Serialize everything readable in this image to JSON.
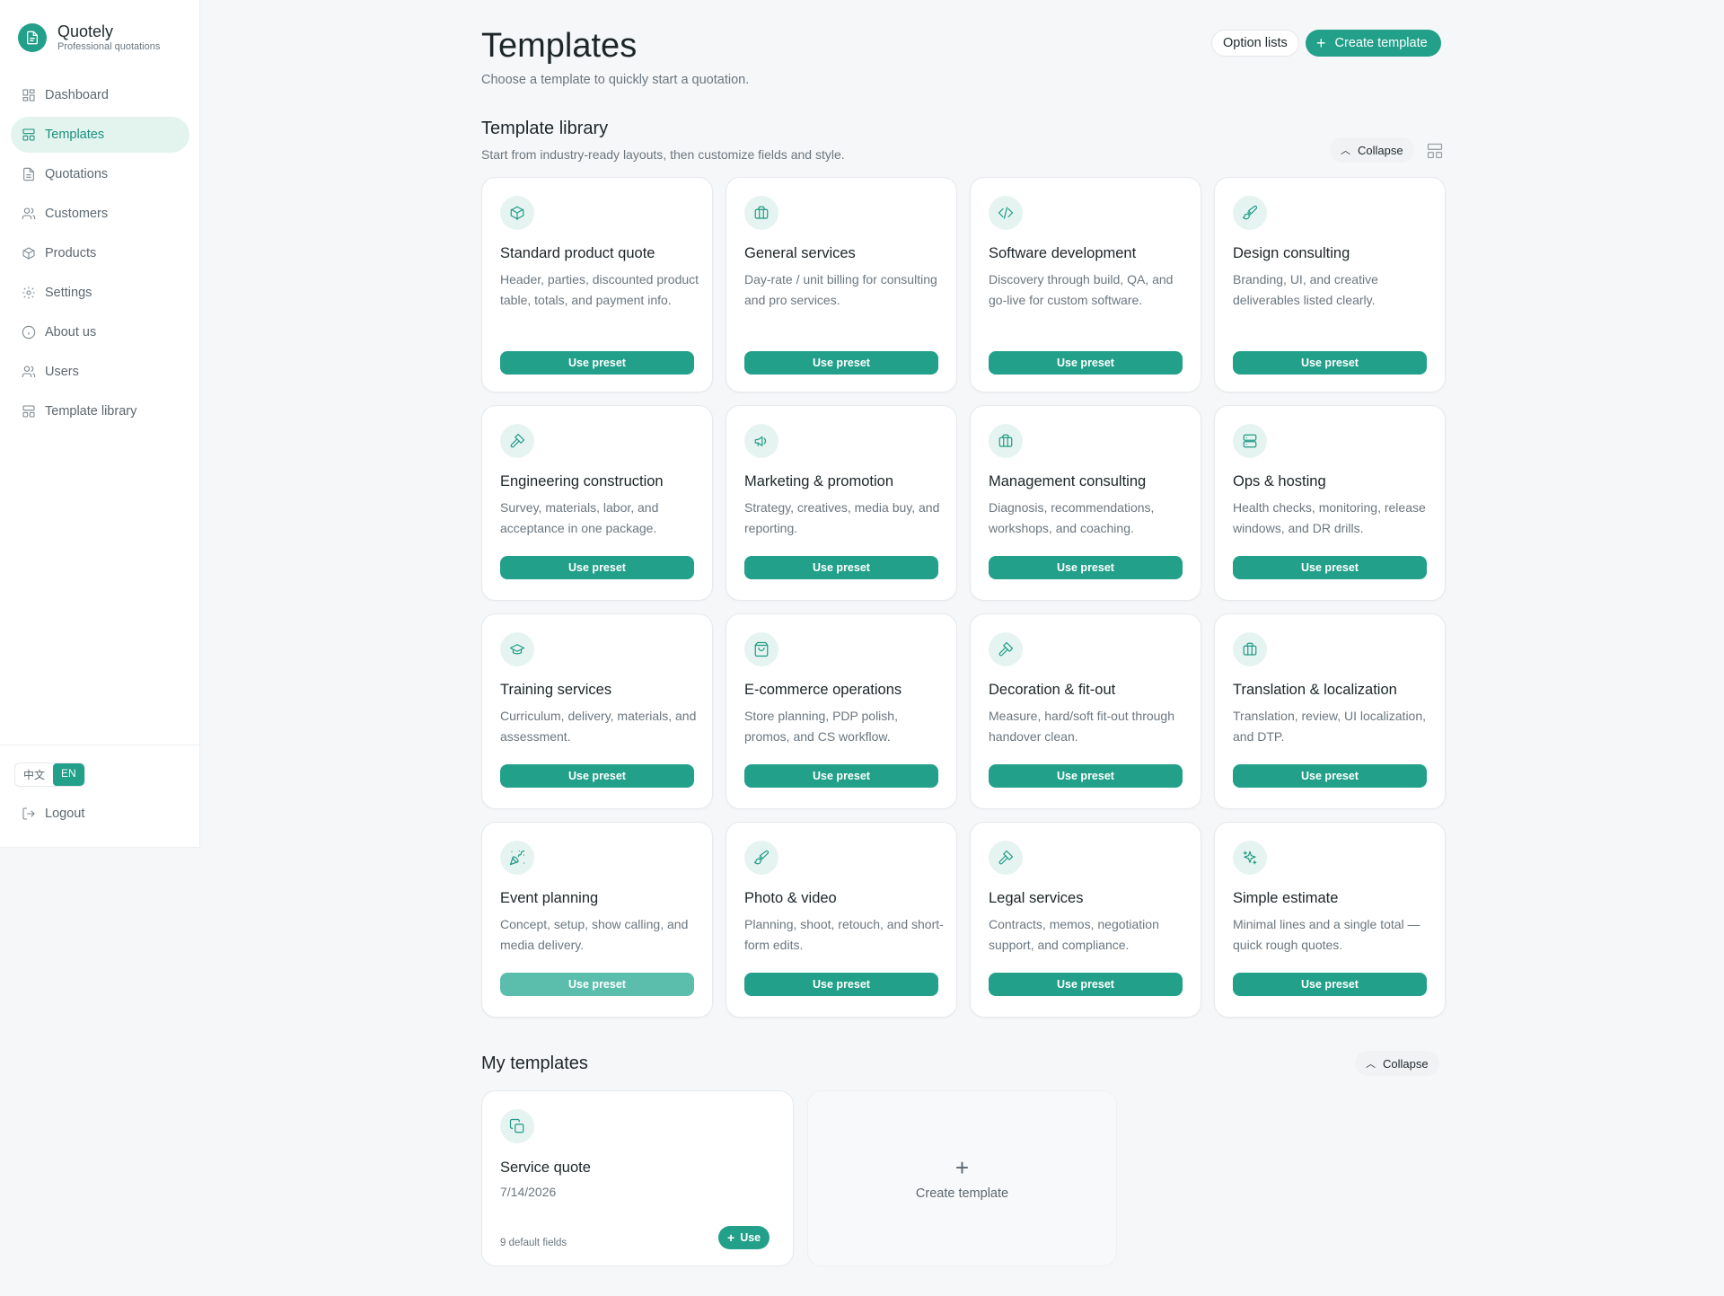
{
  "brand": {
    "name": "Quotely",
    "subtitle": "Professional quotations"
  },
  "nav": [
    {
      "label": "Dashboard",
      "icon": "dashboard-icon",
      "active": false
    },
    {
      "label": "Templates",
      "icon": "templates-icon",
      "active": true
    },
    {
      "label": "Quotations",
      "icon": "document-icon",
      "active": false
    },
    {
      "label": "Customers",
      "icon": "customers-icon",
      "active": false
    },
    {
      "label": "Products",
      "icon": "box-icon",
      "active": false
    },
    {
      "label": "Settings",
      "icon": "gear-icon",
      "active": false
    },
    {
      "label": "About us",
      "icon": "info-icon",
      "active": false
    },
    {
      "label": "Users",
      "icon": "users-icon",
      "active": false
    },
    {
      "label": "Template library",
      "icon": "templates-icon",
      "active": false
    }
  ],
  "language": {
    "zh": "中文",
    "en": "EN",
    "selected": "EN"
  },
  "logout_label": "Logout",
  "header": {
    "title": "Templates",
    "subtitle": "Choose a template to quickly start a quotation.",
    "option_lists_label": "Option lists",
    "create_template_label": "Create template"
  },
  "library": {
    "title": "Template library",
    "subtitle": "Start from industry-ready layouts, then customize fields and style.",
    "collapse_label": "Collapse",
    "use_label": "Use preset",
    "cards": [
      {
        "title": "Standard product quote",
        "desc": "Header, parties, discounted product table, totals, and payment info.",
        "icon": "box-icon"
      },
      {
        "title": "General services",
        "desc": "Day-rate / unit billing for consulting and pro services.",
        "icon": "briefcase-icon"
      },
      {
        "title": "Software development",
        "desc": "Discovery through build, QA, and go-live for custom software.",
        "icon": "code-icon"
      },
      {
        "title": "Design consulting",
        "desc": "Branding, UI, and creative deliverables listed clearly.",
        "icon": "brush-icon"
      },
      {
        "title": "Engineering construction",
        "desc": "Survey, materials, labor, and acceptance in one package.",
        "icon": "hammer-icon"
      },
      {
        "title": "Marketing & promotion",
        "desc": "Strategy, creatives, media buy, and reporting.",
        "icon": "megaphone-icon"
      },
      {
        "title": "Management consulting",
        "desc": "Diagnosis, recommendations, workshops, and coaching.",
        "icon": "briefcase-icon"
      },
      {
        "title": "Ops & hosting",
        "desc": "Health checks, monitoring, release windows, and DR drills.",
        "icon": "server-icon"
      },
      {
        "title": "Training services",
        "desc": "Curriculum, delivery, materials, and assessment.",
        "icon": "graduation-cap-icon"
      },
      {
        "title": "E-commerce operations",
        "desc": "Store planning, PDP polish, promos, and CS workflow.",
        "icon": "shopping-bag-icon"
      },
      {
        "title": "Decoration & fit-out",
        "desc": "Measure, hard/soft fit-out through handover clean.",
        "icon": "hammer-icon"
      },
      {
        "title": "Translation & localization",
        "desc": "Translation, review, UI localization, and DTP.",
        "icon": "briefcase-icon"
      },
      {
        "title": "Event planning",
        "desc": "Concept, setup, show calling, and media delivery.",
        "icon": "party-popper-icon"
      },
      {
        "title": "Photo & video",
        "desc": "Planning, shoot, retouch, and short-form edits.",
        "icon": "brush-icon"
      },
      {
        "title": "Legal services",
        "desc": "Contracts, memos, negotiation support, and compliance.",
        "icon": "hammer-icon"
      },
      {
        "title": "Simple estimate",
        "desc": "Minimal lines and a single total — quick rough quotes.",
        "icon": "sparkles-icon"
      }
    ]
  },
  "my_templates": {
    "title": "My templates",
    "collapse_label": "Collapse",
    "items": [
      {
        "title": "Service quote",
        "date": "7/14/2026",
        "fields": "9 default fields",
        "use_label": "Use",
        "icon": "copy-icon"
      }
    ],
    "create_label": "Create template"
  },
  "colors": {
    "accent": "#22a08a",
    "accent_light_bg": "#e3f4ef",
    "page_bg": "#f6f7f9"
  }
}
